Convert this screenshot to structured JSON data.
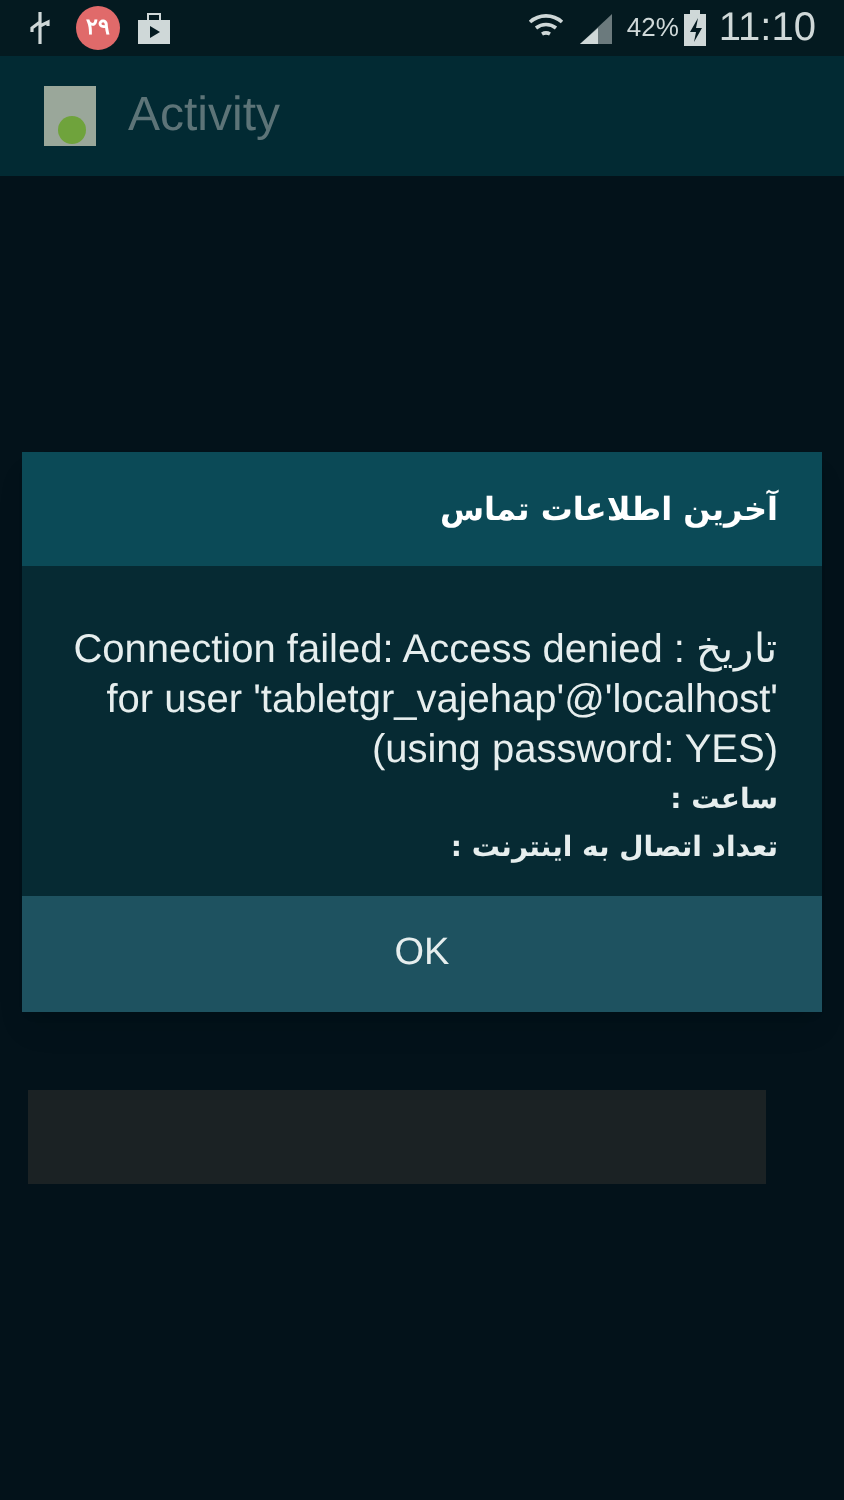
{
  "status_bar": {
    "badge": "۲۹",
    "battery": "42%",
    "time": "11:10"
  },
  "action_bar": {
    "title": "Activity"
  },
  "dialog": {
    "title": "آخرین اطلاعات تماس",
    "lines": [
      "تاریخ : Connection failed: Access denied for user 'tabletgr_vajehap'@'localhost' (using password: YES)",
      "ساعت :",
      "تعداد اتصال به اینترنت :"
    ],
    "buttons": [
      "OK"
    ]
  }
}
